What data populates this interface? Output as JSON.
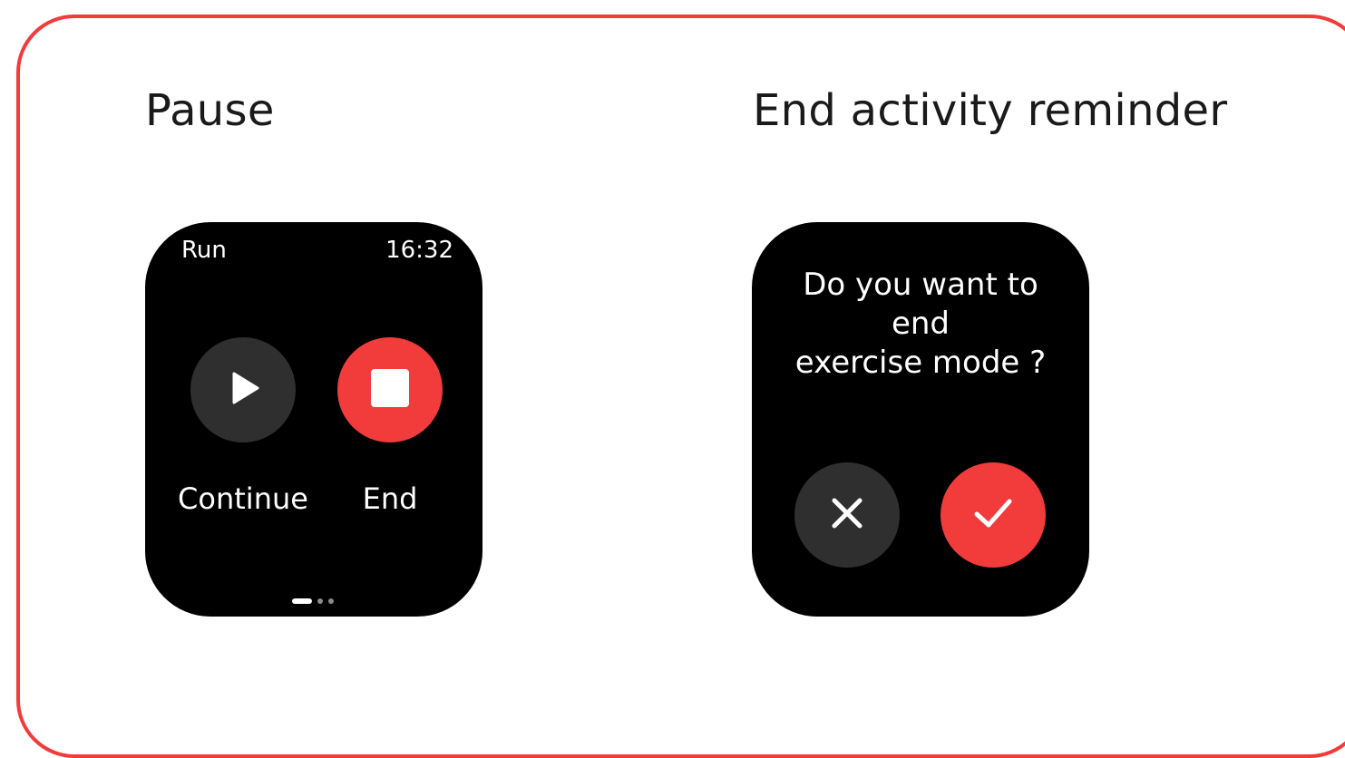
{
  "pause_screen": {
    "heading": "Pause",
    "watch": {
      "app_name": "Run",
      "time": "16:32",
      "continue_label": "Continue",
      "end_label": "End",
      "page_indicator": {
        "total": 3,
        "active": 1
      }
    }
  },
  "end_reminder_screen": {
    "heading": "End activity reminder",
    "watch": {
      "question_lines": [
        "Do you want to",
        "end",
        "exercise mode ?"
      ],
      "cancel_icon": "close-icon",
      "confirm_icon": "check-icon"
    }
  },
  "colors": {
    "accent_red": "#f23b3b",
    "button_dark": "#2f2f2f",
    "watch_background": "#000000"
  }
}
